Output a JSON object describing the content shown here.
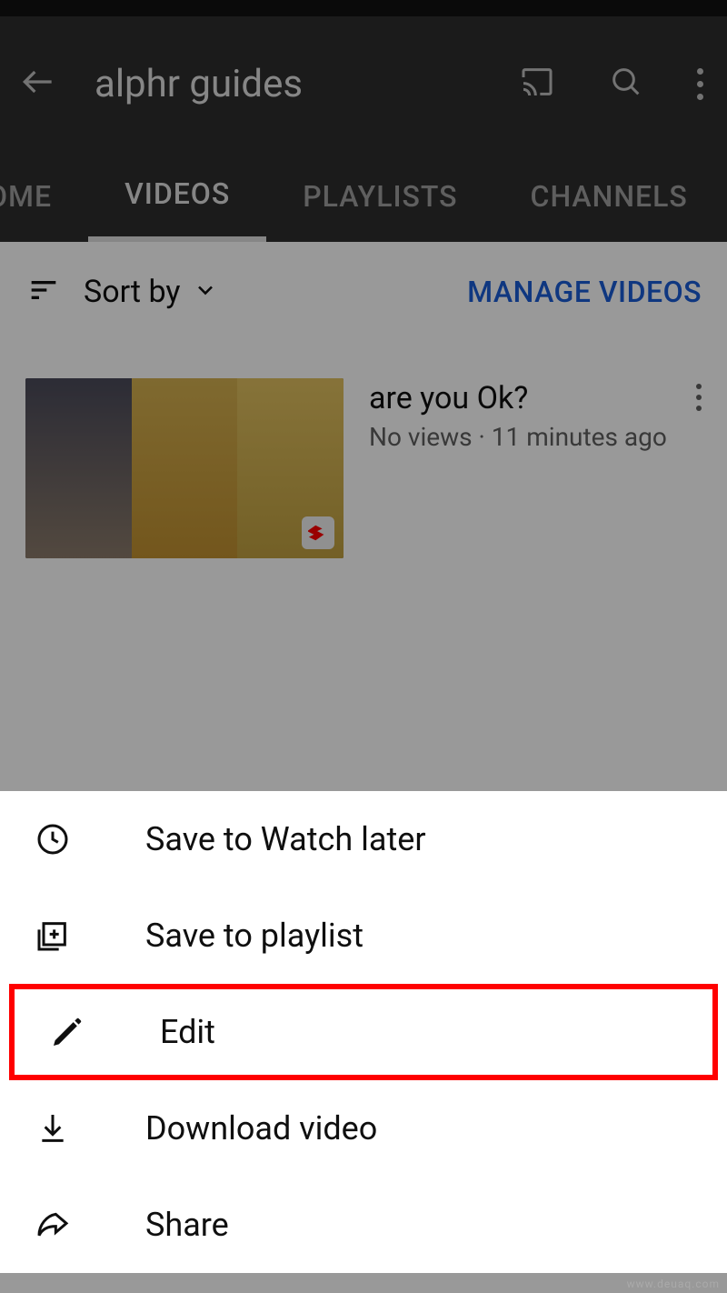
{
  "header": {
    "title": "alphr guides"
  },
  "tabs": {
    "items": [
      {
        "label": "OME"
      },
      {
        "label": "VIDEOS"
      },
      {
        "label": "PLAYLISTS"
      },
      {
        "label": "CHANNELS"
      }
    ],
    "activeIndex": 1
  },
  "sort": {
    "label": "Sort by",
    "manage": "MANAGE VIDEOS"
  },
  "video": {
    "title": "are you Ok?",
    "subtitle": "No views · 11 minutes ago"
  },
  "sheet": {
    "items": [
      {
        "icon": "clock-icon",
        "label": "Save to Watch later"
      },
      {
        "icon": "playlist-add-icon",
        "label": "Save to playlist"
      },
      {
        "icon": "pencil-icon",
        "label": "Edit"
      },
      {
        "icon": "download-icon",
        "label": "Download video"
      },
      {
        "icon": "share-icon",
        "label": "Share"
      }
    ],
    "highlightIndex": 2
  },
  "watermark": "www.deuaq.com"
}
